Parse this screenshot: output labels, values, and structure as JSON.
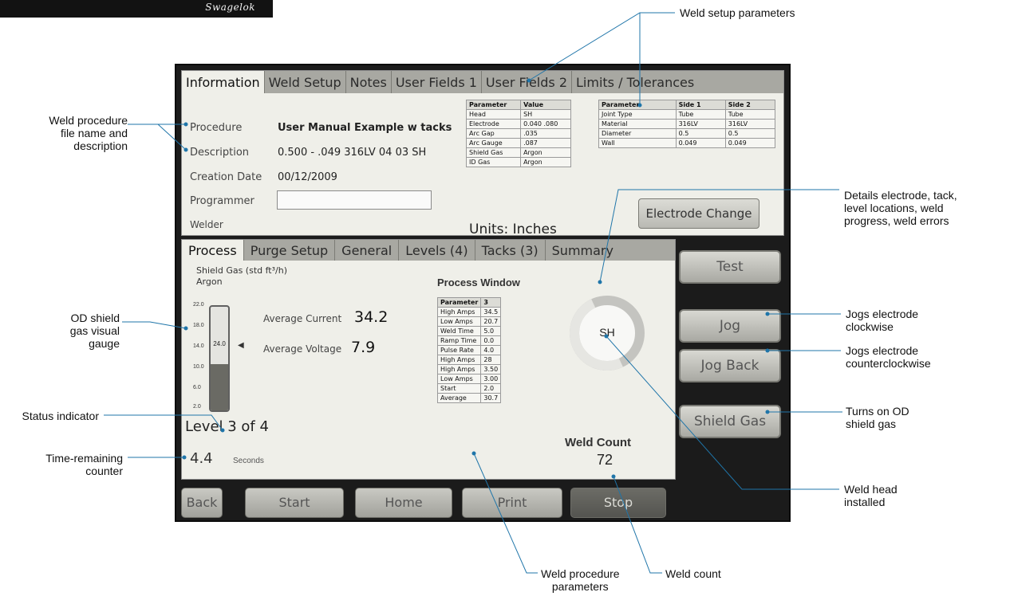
{
  "logo": {
    "text": "Swagelok"
  },
  "top_tabs": [
    "Information",
    "Weld Setup",
    "Notes",
    "User Fields 1",
    "User Fields 2",
    "Limits / Tolerances"
  ],
  "info": {
    "procedure_label": "Procedure",
    "procedure_value": "User Manual Example w tacks",
    "description_label": "Description",
    "description_value": "0.500 - .049 316LV 04 03 SH",
    "creation_label": "Creation Date",
    "creation_value": "00/12/2009",
    "programmer_label": "Programmer",
    "programmer_value": "",
    "welder_label": "Welder"
  },
  "param_table": {
    "headers": [
      "Parameter",
      "Value"
    ],
    "rows": [
      [
        "Head",
        "SH"
      ],
      [
        "Electrode",
        "0.040 .080"
      ],
      [
        "Arc Gap",
        ".035"
      ],
      [
        "Arc Gauge",
        ".087"
      ],
      [
        "Shield Gas",
        "Argon"
      ],
      [
        "ID Gas",
        "Argon"
      ]
    ]
  },
  "side_table": {
    "headers": [
      "Parameter",
      "Side 1",
      "Side 2"
    ],
    "rows": [
      [
        "Joint Type",
        "Tube",
        "Tube"
      ],
      [
        "Material",
        "316LV",
        "316LV"
      ],
      [
        "Diameter",
        "0.5",
        "0.5"
      ],
      [
        "Wall",
        "0.049",
        "0.049"
      ]
    ]
  },
  "units": "Units: Inches",
  "electrode_change": "Electrode Change",
  "main_tabs": [
    "Process",
    "Purge Setup",
    "General",
    "Levels (4)",
    "Tacks (3)",
    "Summary"
  ],
  "process": {
    "shield_gas_label": "Shield Gas (std ft³/h)",
    "shield_gas_type": "Argon",
    "gauge_ticks": [
      "22.0",
      "18.0",
      "14.0",
      "10.0",
      "6.0",
      "2.0"
    ],
    "gauge_value": "24.0",
    "gauge_fill_fraction": 0.45,
    "avg_current_label": "Average Current",
    "avg_current_value": "34.2",
    "avg_voltage_label": "Average Voltage",
    "avg_voltage_value": "7.9",
    "level_text": "Level 3 of 4",
    "time_value": "4.4",
    "time_unit": "Seconds",
    "process_window_title": "Process Window",
    "ring_label": "SH",
    "weld_count_label": "Weld Count",
    "weld_count_value": "72"
  },
  "process_window": {
    "headers": [
      "Parameter",
      "3"
    ],
    "rows": [
      [
        "High Amps",
        "34.5"
      ],
      [
        "Low Amps",
        "20.7"
      ],
      [
        "Weld Time",
        "5.0"
      ],
      [
        "Ramp Time",
        "0.0"
      ],
      [
        "Pulse Rate",
        "4.0"
      ],
      [
        "High Amps",
        "28"
      ],
      [
        "High Amps",
        "3.50"
      ],
      [
        "Low Amps",
        "3.00"
      ],
      [
        "Start",
        "2.0"
      ],
      [
        "Average",
        "30.7"
      ]
    ]
  },
  "side_buttons": [
    "Test",
    "Jog",
    "Jog Back",
    "Shield Gas"
  ],
  "bottom_buttons": [
    "Back",
    "Start",
    "Home",
    "Print",
    "Stop"
  ],
  "annotations": {
    "weld_setup": "Weld setup parameters",
    "procedure_file": [
      "Weld procedure",
      "file name and",
      "description"
    ],
    "details_electrode": [
      "Details electrode, tack,",
      "level locations, weld",
      "progress, weld errors"
    ],
    "od_gauge": [
      "OD shield",
      "gas visual",
      "gauge"
    ],
    "jog_cw": [
      "Jogs electrode",
      "clockwise"
    ],
    "jog_ccw": [
      "Jogs electrode",
      "counterclockwise"
    ],
    "status": "Status indicator",
    "turns_on": [
      "Turns on OD",
      "shield gas"
    ],
    "time_remaining": [
      "Time-remaining",
      "counter"
    ],
    "weld_head": [
      "Weld head",
      "installed"
    ],
    "weld_proc_params": [
      "Weld procedure",
      "parameters"
    ],
    "weld_count": "Weld count"
  }
}
